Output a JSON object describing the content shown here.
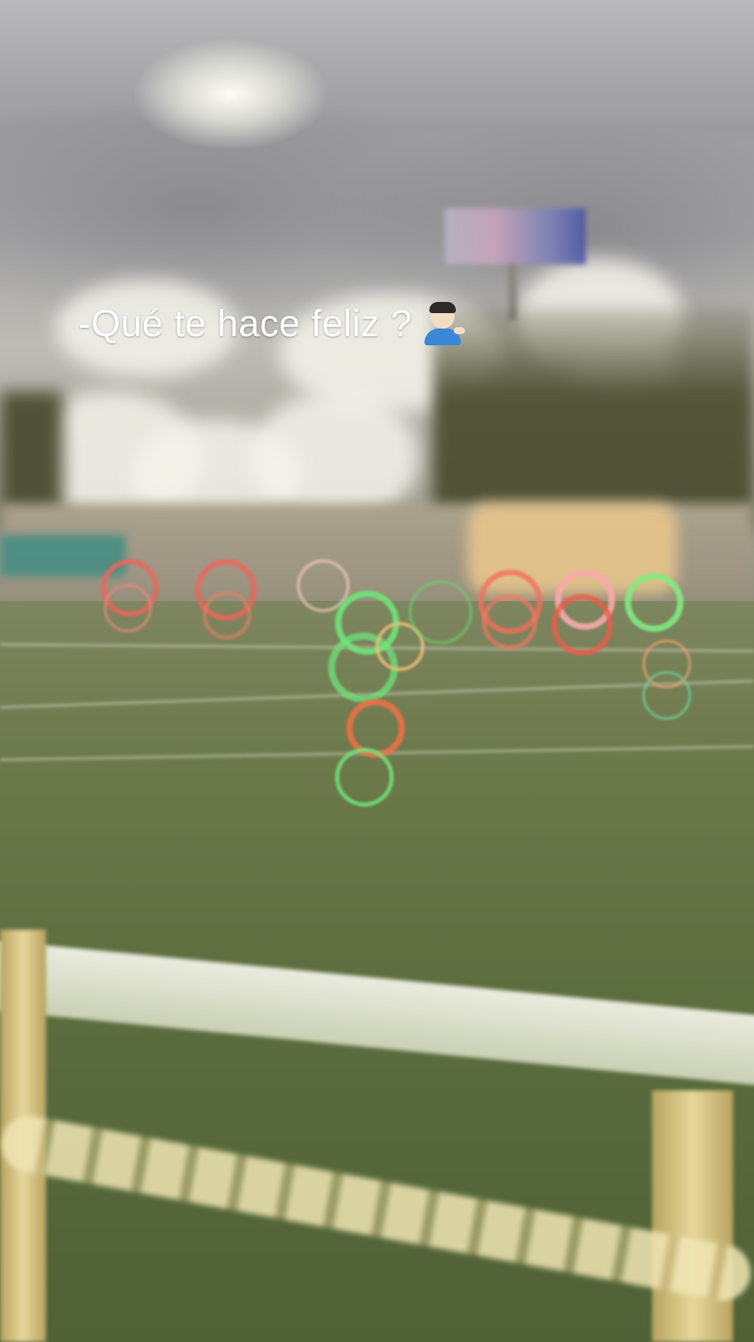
{
  "caption": {
    "text": "-Qué te hace feliz ?",
    "emoji_icon": "person-tipping-hand-icon"
  },
  "scene": {
    "description_colors": {
      "sky": "#a6a6a8",
      "turf": "#5d6e3f",
      "ring_green": "#6ee07a",
      "ring_red": "#f06a5a",
      "fence": "#f3f1e4"
    }
  }
}
